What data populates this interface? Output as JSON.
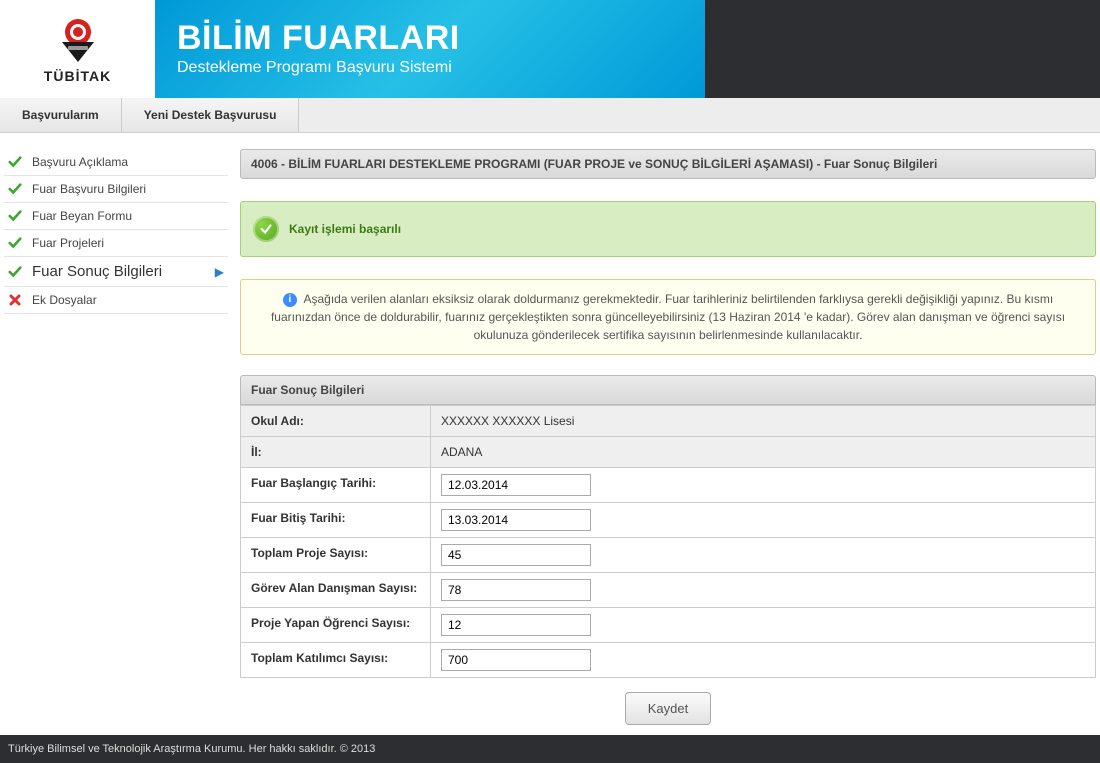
{
  "header": {
    "logo_label": "TÜBİTAK",
    "title": "BİLİM FUARLARI",
    "subtitle": "Destekleme Programı Başvuru Sistemi"
  },
  "tabs": {
    "tab1": "Başvurularım",
    "tab2": "Yeni Destek Başvurusu"
  },
  "sidebar": {
    "items": [
      {
        "label": "Başvuru Açıklama",
        "status": "done"
      },
      {
        "label": "Fuar Başvuru Bilgileri",
        "status": "done"
      },
      {
        "label": "Fuar Beyan Formu",
        "status": "done"
      },
      {
        "label": "Fuar Projeleri",
        "status": "done"
      },
      {
        "label": "Fuar Sonuç Bilgileri",
        "status": "active"
      },
      {
        "label": "Ek Dosyalar",
        "status": "pending"
      }
    ]
  },
  "content": {
    "title": "4006 - BİLİM FUARLARI DESTEKLEME PROGRAMI (FUAR PROJE ve SONUÇ BİLGİLERİ AŞAMASI) - Fuar Sonuç Bilgileri",
    "success": "Kayıt işlemi başarılı",
    "info": "Aşağıda verilen alanları eksiksiz olarak doldurmanız gerekmektedir. Fuar tarihleriniz belirtilenden farklıysa gerekli değişikliği yapınız. Bu kısmı fuarınızdan önce de doldurabilir, fuarınız gerçekleştikten sonra güncelleyebilirsiniz (13 Haziran 2014 'e kadar). Görev alan danışman ve öğrenci sayısı okulunuza gönderilecek sertifika sayısının belirlenmesinde kullanılacaktır.",
    "section_title": "Fuar Sonuç Bilgileri",
    "form": {
      "okul_adi_label": "Okul Adı:",
      "okul_adi_value": "XXXXXX XXXXXX Lisesi",
      "il_label": "İl:",
      "il_value": "ADANA",
      "baslangic_label": "Fuar Başlangıç Tarihi:",
      "baslangic_value": "12.03.2014",
      "bitis_label": "Fuar Bitiş Tarihi:",
      "bitis_value": "13.03.2014",
      "proje_label": "Toplam Proje Sayısı:",
      "proje_value": "45",
      "danisman_label": "Görev Alan Danışman Sayısı:",
      "danisman_value": "78",
      "ogrenci_label": "Proje Yapan Öğrenci Sayısı:",
      "ogrenci_value": "12",
      "katilimci_label": "Toplam Katılımcı Sayısı:",
      "katilimci_value": "700"
    },
    "save_button": "Kaydet"
  },
  "footer": {
    "text": "Türkiye Bilimsel ve Teknolojik Araştırma Kurumu. Her hakkı saklıdır. © 2013"
  }
}
